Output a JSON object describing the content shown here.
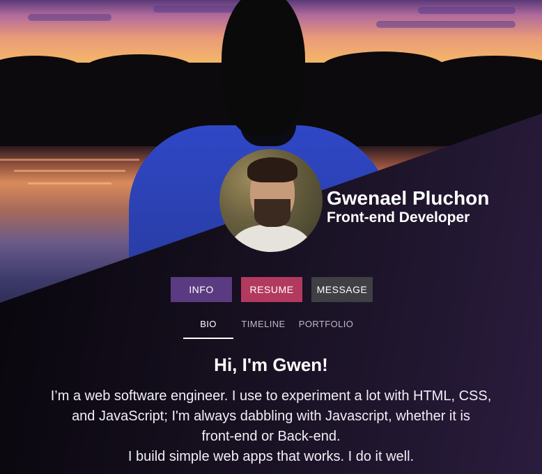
{
  "hero": {
    "image": "sunset-lake-person-photo"
  },
  "profile": {
    "avatar": "profile-photo",
    "name": "Gwenael Pluchon",
    "role": "Front-end Developer"
  },
  "actions": {
    "info_label": "INFO",
    "resume_label": "RESUME",
    "message_label": "MESSAGE"
  },
  "tabs": [
    {
      "label": "BIO",
      "active": true
    },
    {
      "label": "TIMELINE",
      "active": false
    },
    {
      "label": "PORTFOLIO",
      "active": false
    }
  ],
  "bio": {
    "title": "Hi, I'm Gwen!",
    "lines": [
      "I’m a web software engineer. I use to experiment a lot with HTML, CSS,",
      "and JavaScript; I'm always dabbling with Javascript, whether it is",
      "front-end or Back-end.",
      "I build simple web apps that works. I do it well."
    ]
  },
  "colors": {
    "info_button": "#5a3a80",
    "resume_button": "#b23a5e",
    "message_button": "#3f3f44",
    "panel": "#1a1226"
  }
}
